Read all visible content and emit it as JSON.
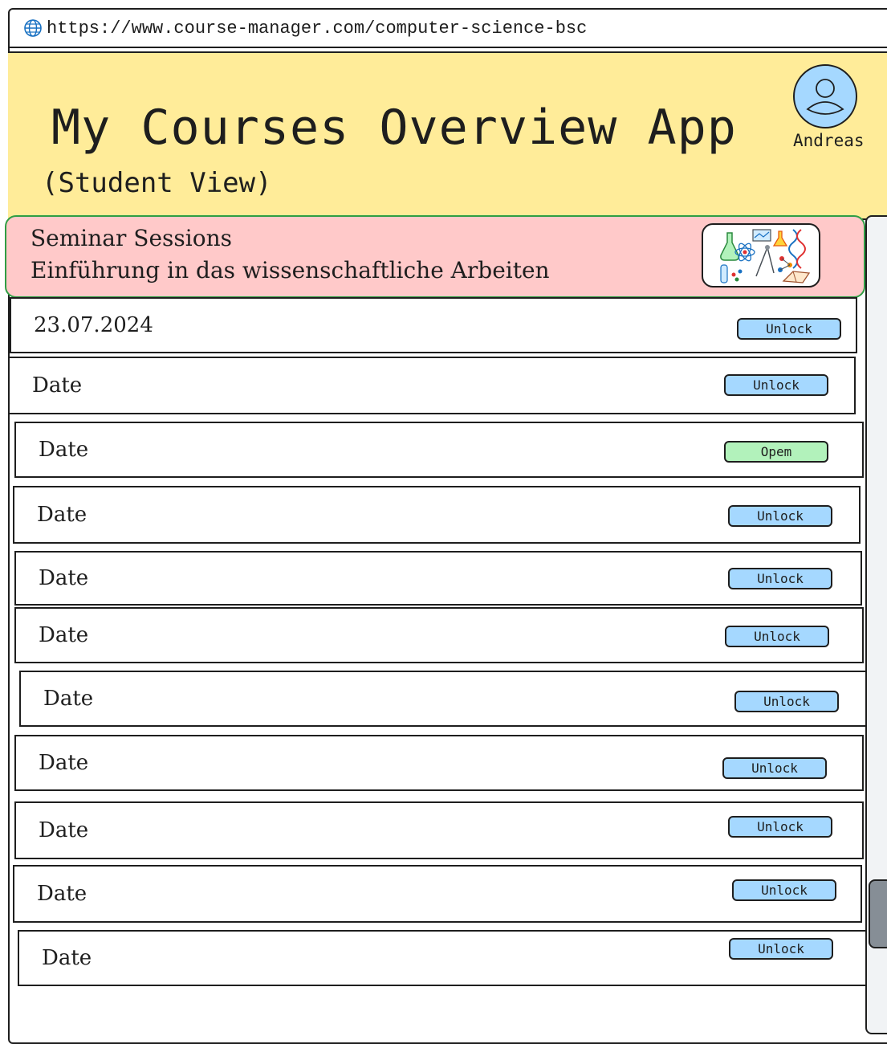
{
  "browser": {
    "url": "https://www.course-manager.com/computer-science-bsc"
  },
  "header": {
    "title": "My Courses Overview App",
    "subtitle": "(Student View)",
    "user_name": "Andreas"
  },
  "course": {
    "category": "Seminar Sessions",
    "name": "Einführung in das wissenschaftliche Arbeiten",
    "image_icon": "science-collage-icon"
  },
  "sessions": [
    {
      "date": "23.07.2024",
      "action": "Unlock"
    },
    {
      "date": "Date",
      "action": "Unlock"
    },
    {
      "date": "Date",
      "action": "Opem"
    },
    {
      "date": "Date",
      "action": "Unlock"
    },
    {
      "date": "Date",
      "action": "Unlock"
    },
    {
      "date": "Date",
      "action": "Unlock"
    },
    {
      "date": "Date",
      "action": "Unlock"
    },
    {
      "date": "Date",
      "action": "Unlock"
    },
    {
      "date": "Date",
      "action": "Unlock"
    },
    {
      "date": "Date",
      "action": "Unlock"
    },
    {
      "date": "Date",
      "action": "Unlock"
    }
  ],
  "colors": {
    "header_bg": "#ffec99",
    "course_card_bg": "#ffc9c9",
    "unlock_button": "#a5d8ff",
    "open_button": "#b2f2bb"
  }
}
